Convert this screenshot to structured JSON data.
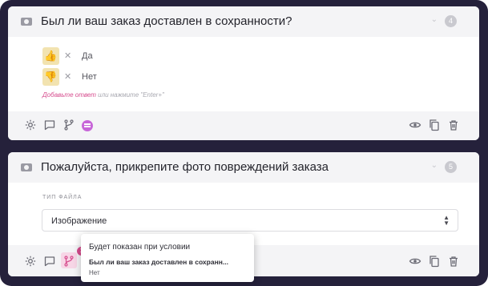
{
  "questions": [
    {
      "title": "Был ли ваш заказ доставлен в сохранности?",
      "number": "4",
      "type_icon": "image-icon",
      "answers": [
        {
          "label": "Да",
          "icon": "thumbs-up-icon",
          "glyph": "👍"
        },
        {
          "label": "Нет",
          "icon": "thumbs-down-icon",
          "glyph": "👎"
        }
      ],
      "add_answer": "Добавьте ответ",
      "add_hint": "или нажмите \"Enter+\"",
      "footer_icons": [
        "settings-icon",
        "comment-icon",
        "branch-icon",
        "logic-icon",
        "preview-icon",
        "copy-icon",
        "delete-icon"
      ]
    },
    {
      "title": "Пожалуйста, прикрепите фото повреждений заказа",
      "number": "5",
      "type_icon": "image-icon",
      "file_type_label": "ТИП ФАЙЛА",
      "file_type_value": "Изображение",
      "branch_badge": "1",
      "footer_icons": [
        "settings-icon",
        "comment-icon",
        "branch-icon",
        "preview-icon",
        "copy-icon",
        "delete-icon"
      ]
    }
  ],
  "popover": {
    "title": "Будет показан при условии",
    "question": "Был ли ваш заказ доставлен в сохранн...",
    "answer": "Нет"
  },
  "colors": {
    "frame": "#25213b",
    "accent": "#d64b8d",
    "panel": "#f4f4f6"
  }
}
